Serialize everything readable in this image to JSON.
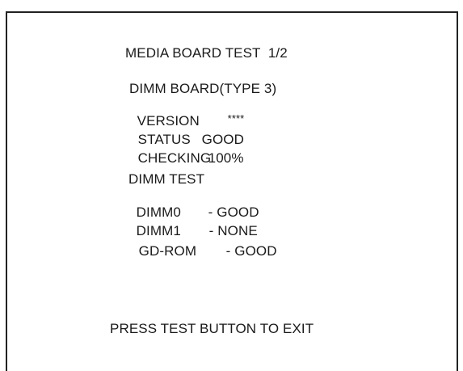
{
  "screen": {
    "title": "MEDIA BOARD TEST  1/2",
    "board": {
      "name": "DIMM BOARD(TYPE 3)",
      "version_label": "VERSION",
      "version_value": "****",
      "status_label": "STATUS",
      "status_value": "GOOD",
      "checking_label": "CHECKING",
      "checking_value": "100%"
    },
    "dimm_test": {
      "heading": "DIMM TEST",
      "items": [
        {
          "label": "DIMM0",
          "result": "- GOOD"
        },
        {
          "label": "DIMM1",
          "result": "- NONE"
        },
        {
          "label": "GD-ROM",
          "result": "- GOOD"
        }
      ]
    },
    "footer": "PRESS TEST BUTTON TO EXIT"
  },
  "colors": {
    "background": "#ffffff",
    "text": "#1a1a1a",
    "border": "#222222"
  }
}
